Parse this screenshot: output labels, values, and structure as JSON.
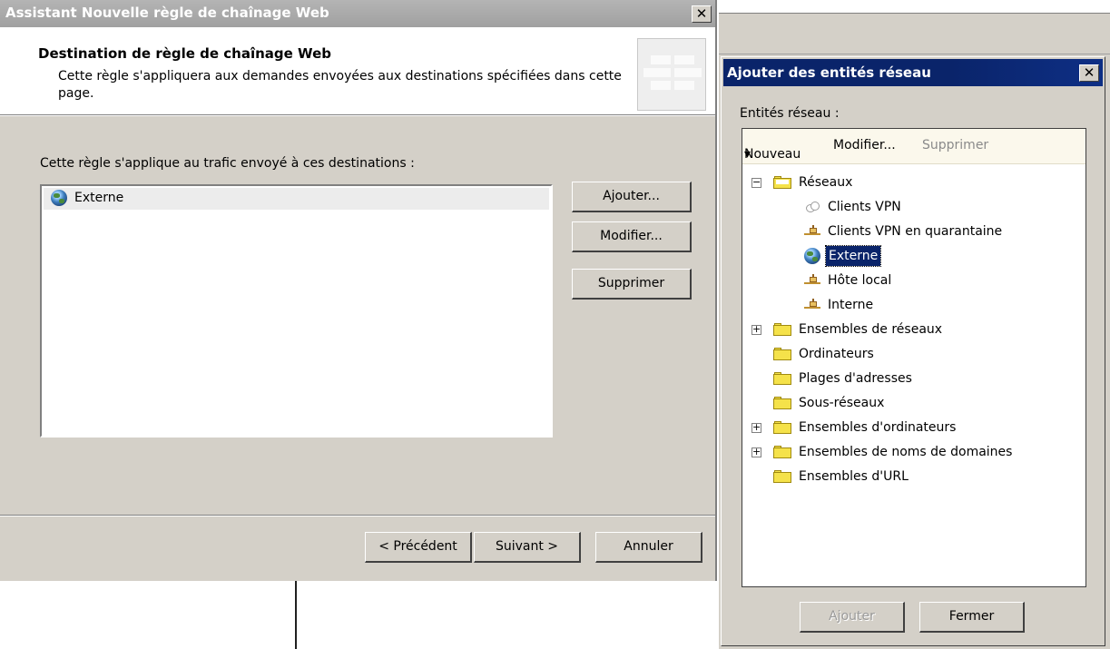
{
  "wizard": {
    "title": "Assistant Nouvelle règle de chaînage Web",
    "close_glyph": "✕",
    "header_title": "Destination de règle de chaînage Web",
    "header_desc": "Cette règle s'appliquera aux demandes envoyées aux destinations spécifiées dans cette page.",
    "rule_label": "Cette règle s'applique au trafic envoyé à ces destinations :",
    "destinations": [
      {
        "label": "Externe",
        "icon": "globe-icon"
      }
    ],
    "buttons": {
      "add": "Ajouter...",
      "edit": "Modifier...",
      "delete": "Supprimer",
      "back": "< Précédent",
      "next": "Suivant >",
      "cancel": "Annuler"
    }
  },
  "dialog": {
    "title": "Ajouter des entités réseau",
    "close_glyph": "✕",
    "entities_label": "Entités réseau :",
    "toolbar": {
      "new": "Nouveau",
      "new_arrow": "▾",
      "edit": "Modifier...",
      "delete": "Supprimer"
    },
    "tree": {
      "root": {
        "label": "Réseaux",
        "expander": "−"
      },
      "children": [
        {
          "label": "Clients VPN",
          "icon": "cloud-icon"
        },
        {
          "label": "Clients VPN en quarantaine",
          "icon": "network-icon"
        },
        {
          "label": "Externe",
          "icon": "globe-icon",
          "selected": true
        },
        {
          "label": "Hôte local",
          "icon": "network-icon"
        },
        {
          "label": "Interne",
          "icon": "network-icon"
        }
      ],
      "folders": [
        {
          "label": "Ensembles de réseaux",
          "expander": "+"
        },
        {
          "label": "Ordinateurs",
          "expander": ""
        },
        {
          "label": "Plages d'adresses",
          "expander": ""
        },
        {
          "label": "Sous-réseaux",
          "expander": ""
        },
        {
          "label": "Ensembles d'ordinateurs",
          "expander": "+"
        },
        {
          "label": "Ensembles de noms de domaines",
          "expander": "+"
        },
        {
          "label": "Ensembles d'URL",
          "expander": ""
        }
      ]
    },
    "buttons": {
      "add": "Ajouter",
      "close": "Fermer"
    }
  }
}
